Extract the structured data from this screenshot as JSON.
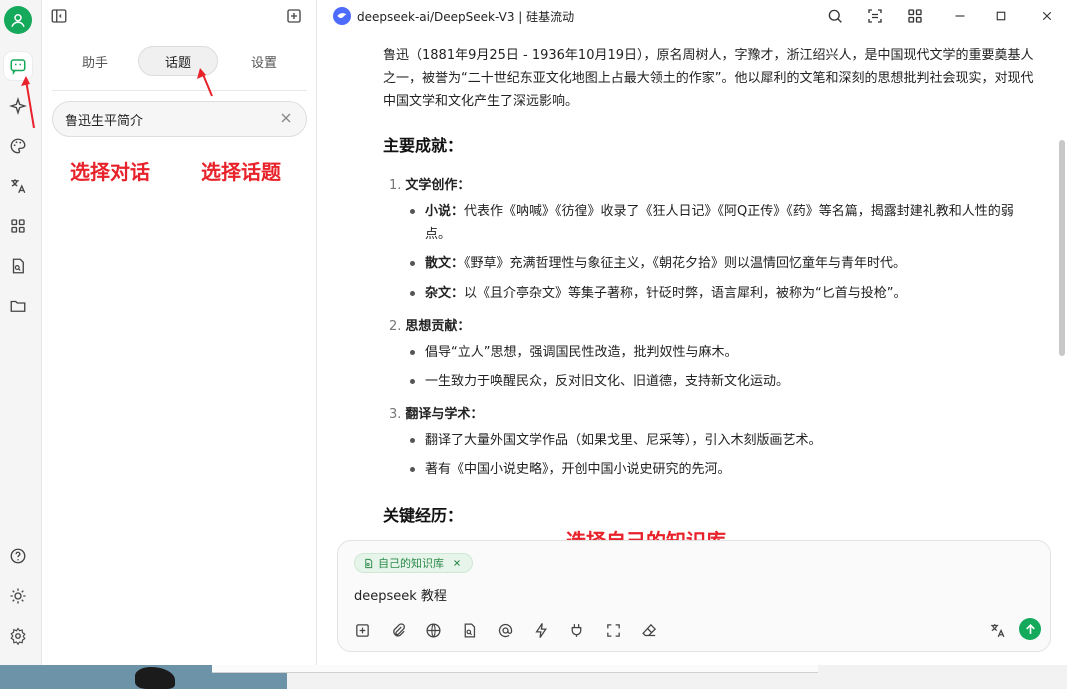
{
  "window": {
    "title": "deepseek-ai/DeepSeek-V3 | 硅基流动"
  },
  "sidebar_tabs": {
    "assistant": "助手",
    "topics": "话题",
    "settings": "设置"
  },
  "topics": [
    {
      "label": "鲁迅生平简介"
    }
  ],
  "annotations": {
    "select_chat": "选择对话",
    "select_topic": "选择话题",
    "select_kb": "选择自己的知识库"
  },
  "message": {
    "intro": "鲁迅（1881年9月25日 - 1936年10月19日），原名周树人，字豫才，浙江绍兴人，是中国现代文学的重要奠基人之一，被誉为“二十世纪东亚文化地图上占最大领土的作家”。他以犀利的文笔和深刻的思想批判社会现实，对现代中国文学和文化产生了深远影响。",
    "achievements_heading": "主要成就：",
    "sections": [
      {
        "num": "1.",
        "title": "文学创作：",
        "items": [
          {
            "bold": "小说：",
            "text": "代表作《呐喊》《彷徨》收录了《狂人日记》《阿Q正传》《药》等名篇，揭露封建礼教和人性的弱点。"
          },
          {
            "bold": "散文：",
            "text": "《野草》充满哲理性与象征主义，《朝花夕拾》则以温情回忆童年与青年时代。"
          },
          {
            "bold": "杂文：",
            "text": "以《且介亭杂文》等集子著称，针砭时弊，语言犀利，被称为“匕首与投枪”。"
          }
        ]
      },
      {
        "num": "2.",
        "title": "思想贡献：",
        "items": [
          {
            "bold": "",
            "text": "倡导“立人”思想，强调国民性改造，批判奴性与麻木。"
          },
          {
            "bold": "",
            "text": "一生致力于唤醒民众，反对旧文化、旧道德，支持新文化运动。"
          }
        ]
      },
      {
        "num": "3.",
        "title": "翻译与学术：",
        "items": [
          {
            "bold": "",
            "text": "翻译了大量外国文学作品（如果戈里、尼采等），引入木刻版画艺术。"
          },
          {
            "bold": "",
            "text": "著有《中国小说史略》，开创中国小说史研究的先河。"
          }
        ]
      }
    ],
    "experience_heading": "关键经历："
  },
  "input": {
    "knowledge_chip": "自己的知识库",
    "text": "deepseek 教程"
  },
  "colors": {
    "accent_green": "#15a95b",
    "annotation_red": "#e8222a",
    "deepseek_blue": "#4d6bfe"
  },
  "icons": {
    "rail": [
      "chat-icon",
      "sparkle-icon",
      "palette-icon",
      "translate-icon",
      "apps-icon",
      "document-search-icon",
      "folder-icon",
      "help-icon",
      "theme-icon",
      "settings-icon"
    ],
    "titlebar": [
      "search-icon",
      "scan-icon",
      "grid-icon",
      "minimize-icon",
      "maximize-icon",
      "close-icon"
    ],
    "toolbar": [
      "new-topic-icon",
      "attachment-icon",
      "globe-icon",
      "knowledge-icon",
      "mention-icon",
      "lightning-icon",
      "plugin-icon",
      "fullscreen-icon",
      "eraser-icon",
      "translate-icon",
      "send-icon"
    ]
  }
}
